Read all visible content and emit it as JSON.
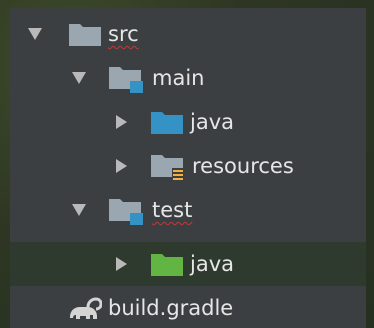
{
  "project_tree": {
    "items": [
      {
        "label": "src",
        "state": "expanded",
        "icon": "folder-icon",
        "spellcheck": true
      },
      {
        "label": "main",
        "state": "expanded",
        "icon": "module-folder-icon",
        "spellcheck": false
      },
      {
        "label": "java",
        "state": "collapsed",
        "icon": "source-folder-icon",
        "spellcheck": false
      },
      {
        "label": "resources",
        "state": "collapsed",
        "icon": "resources-folder-icon",
        "spellcheck": false
      },
      {
        "label": "test",
        "state": "expanded",
        "icon": "test-module-folder-icon",
        "spellcheck": true
      },
      {
        "label": "java",
        "state": "collapsed",
        "icon": "test-source-folder-icon",
        "spellcheck": false,
        "selected": true
      },
      {
        "label": "build.gradle",
        "icon": "gradle-elephant-icon",
        "spellcheck": false
      }
    ]
  },
  "colors": {
    "panel_bg": "#3c3f41",
    "selected_row_bg": "#2f3a2e",
    "text": "#e6e6e6",
    "source_folder": "#3592c4",
    "test_source_folder": "#62b543",
    "folder_gray": "#9aa7b0"
  }
}
